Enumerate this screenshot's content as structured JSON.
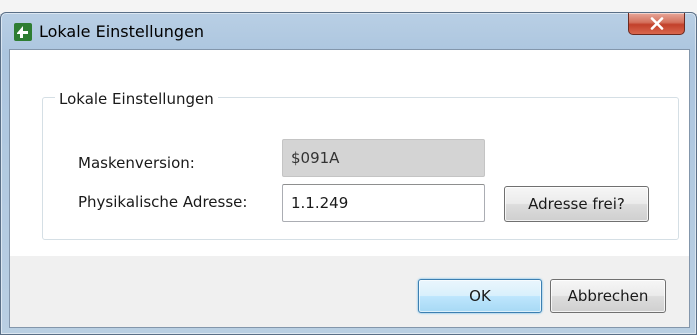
{
  "window": {
    "title": "Lokale Einstellungen",
    "close_glyph": "X",
    "app_icon": "app-logo-icon"
  },
  "background": {
    "text_left": "░░░░░░░░░",
    "text_right": ""
  },
  "group": {
    "legend": "Lokale Einstellungen"
  },
  "fields": {
    "mask_label": "Maskenversion:",
    "mask_value": "$091A",
    "address_label": "Physikalische Adresse:",
    "address_value": "1.1.249"
  },
  "buttons": {
    "address_free": "Adresse frei?",
    "ok": "OK",
    "cancel": "Abbrechen"
  },
  "colors": {
    "close_button": "#c2402a",
    "default_button_border": "#3c7fb1",
    "readonly_field": "#d4d4d4"
  }
}
